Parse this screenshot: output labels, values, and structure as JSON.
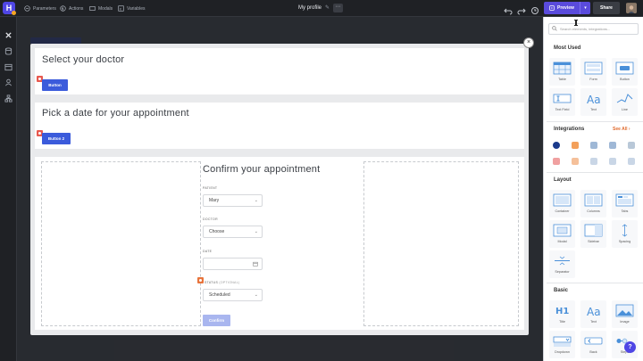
{
  "topbar": {
    "nav": [
      {
        "label": "Parameters",
        "icon": "sliders-icon"
      },
      {
        "label": "Actions",
        "icon": "lightning-icon"
      },
      {
        "label": "Modals",
        "icon": "window-icon"
      },
      {
        "label": "Variables",
        "icon": "braces-icon"
      }
    ],
    "page_title": "My profile",
    "preview_label": "Preview",
    "share_label": "Share"
  },
  "modal": {
    "sections": [
      {
        "heading": "Select your doctor",
        "button": "Button"
      },
      {
        "heading": "Pick a date for your appointment",
        "button": "Button 2"
      }
    ],
    "form": {
      "heading": "Confirm your appointment",
      "patient_label": "PATIENT",
      "patient_value": "Mary",
      "doctor_label": "DOCTOR",
      "doctor_value": "Choose",
      "date_label": "DATE",
      "date_value": "",
      "status_label": "STATUS",
      "status_optional": "(OPTIONAL)",
      "status_value": "Scheduled",
      "confirm_label": "Confirm"
    }
  },
  "panel": {
    "search_placeholder": "Search elements, integrations...",
    "most_used": {
      "heading": "Most Used",
      "items": [
        "Table",
        "Form",
        "Button",
        "Text Field",
        "Text",
        "Line"
      ]
    },
    "integrations": {
      "heading": "Integrations",
      "see_all": "See All"
    },
    "layout": {
      "heading": "Layout",
      "items": [
        "Container",
        "Columns",
        "Tabs",
        "Modal",
        "Sidebar",
        "Spacing",
        "Separator"
      ]
    },
    "basic": {
      "heading": "Basic",
      "items": [
        "Title",
        "Text",
        "Image",
        "Dropdown",
        "Back",
        "Steps"
      ]
    }
  },
  "colors": {
    "accent": "#5a4bdc",
    "button_blue": "#3b5bdb",
    "orange": "#e06a2d"
  }
}
